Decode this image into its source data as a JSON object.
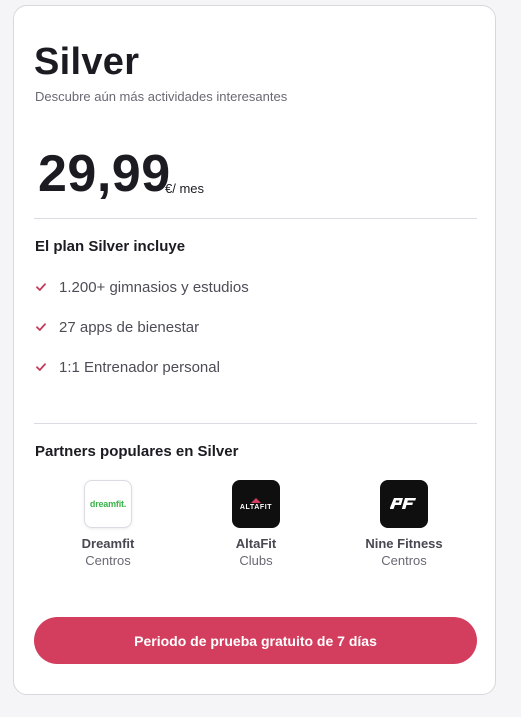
{
  "plan": {
    "title": "Silver",
    "subtitle": "Descubre aún más actividades interesantes",
    "price": "29,99",
    "price_unit": "€/ mes"
  },
  "includes": {
    "heading": "El plan Silver incluye",
    "items": [
      {
        "label": "1.200+ gimnasios y estudios",
        "icon": "check-icon"
      },
      {
        "label": "27 apps de bienestar",
        "icon": "check-icon"
      },
      {
        "label": "1:1 Entrenador personal",
        "icon": "check-icon"
      }
    ]
  },
  "partners": {
    "heading": "Partners populares en Silver",
    "items": [
      {
        "name": "Dreamfit",
        "type": "Centros",
        "logo_text": "dreamfit.",
        "logo_color": "#3bb34a"
      },
      {
        "name": "AltaFit",
        "type": "Clubs",
        "logo_text": "ALTAFIT"
      },
      {
        "name": "Nine Fitness",
        "type": "Centros",
        "logo_text": "9F"
      }
    ]
  },
  "cta": {
    "label": "Periodo de prueba gratuito de 7 días"
  },
  "colors": {
    "accent": "#d33d5e",
    "check": "#c43a5a",
    "text_primary": "#1d1b22",
    "text_secondary": "#6b6873"
  }
}
